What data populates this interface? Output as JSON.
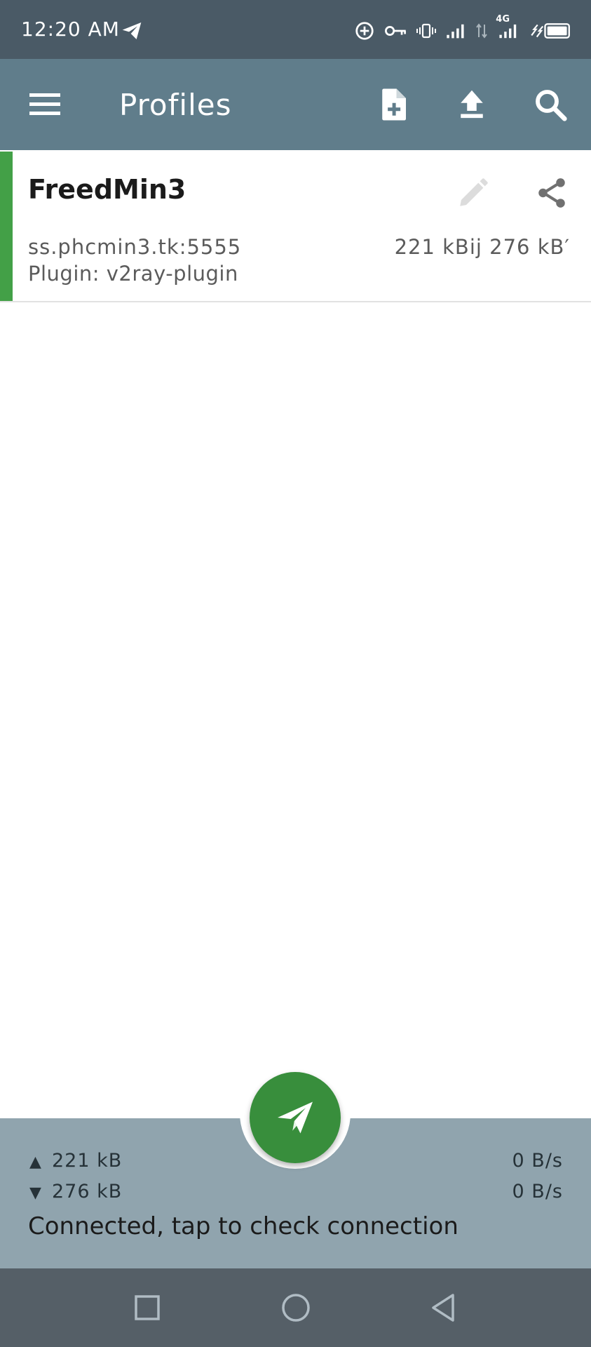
{
  "status_bar": {
    "time": "12:20 AM",
    "network_type": "4G",
    "icons": [
      "telegram-icon",
      "data-saver-icon",
      "vpn-key-icon",
      "vibrate-icon",
      "signal-icon",
      "data-transfer-icon",
      "signal-4g-icon",
      "battery-charging-icon"
    ]
  },
  "app_bar": {
    "title": "Profiles",
    "actions": [
      "add-profile-icon",
      "import-icon",
      "search-icon"
    ]
  },
  "profile": {
    "name": "FreedMin3",
    "server": "ss.phcmin3.tk:5555",
    "traffic": "221 kBij 276 kB′",
    "plugin": "Plugin: v2ray-plugin"
  },
  "bottom_panel": {
    "up_arrow": "▲",
    "down_arrow": "▼",
    "tx_total": "221 kB",
    "rx_total": "276 kB",
    "tx_rate": "0 B/s",
    "rx_rate": "0 B/s",
    "status": "Connected, tap to check connection"
  },
  "colors": {
    "status_bar": "#4a5a66",
    "app_bar": "#607d8b",
    "active_indicator": "#43a047",
    "fab": "#388e3c",
    "bottom_panel": "#90a4ae",
    "nav_bar": "#555f67"
  }
}
